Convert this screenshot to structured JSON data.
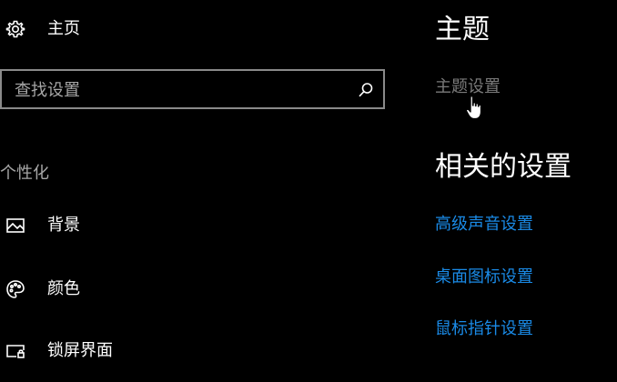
{
  "nav": {
    "home": {
      "label": "主页",
      "icon": "gear-icon"
    },
    "search": {
      "placeholder": "查找设置",
      "value": "",
      "icon": "search-icon"
    },
    "section_label": "个性化",
    "items": [
      {
        "label": "背景",
        "icon": "image-icon"
      },
      {
        "label": "颜色",
        "icon": "palette-icon"
      },
      {
        "label": "锁屏界面",
        "icon": "lock-screen-icon"
      }
    ]
  },
  "main": {
    "title": "主题",
    "theme_settings_link": "主题设置",
    "related_title": "相关的设置",
    "related_links": [
      {
        "label": "高级声音设置"
      },
      {
        "label": "桌面图标设置"
      },
      {
        "label": "鼠标指针设置"
      }
    ]
  },
  "colors": {
    "background": "#000000",
    "text": "#ffffff",
    "muted_text": "#a6a6a6",
    "disabled_link": "#7a7a7a",
    "accent_link": "#1a8ae6",
    "search_border": "#8a8a8a"
  }
}
